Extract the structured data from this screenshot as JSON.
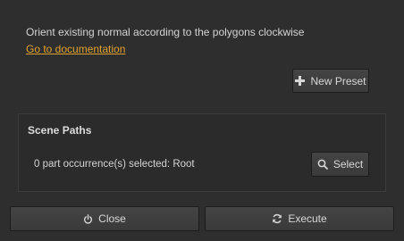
{
  "description": "Orient existing normal according to the polygons clockwise",
  "documentation_link": "Go to documentation",
  "toolbar": {
    "new_preset_label": "New Preset",
    "new_preset_icon": "plus-icon"
  },
  "scene_paths": {
    "title": "Scene Paths",
    "selection_text": "0 part occurrence(s) selected: Root",
    "select_label": "Select",
    "select_icon": "search-icon"
  },
  "footer": {
    "close_label": "Close",
    "close_icon": "power-icon",
    "execute_label": "Execute",
    "execute_icon": "refresh-icon"
  },
  "colors": {
    "background": "#2e2e2e",
    "link": "#e1a22d",
    "text": "#d4d4d4"
  }
}
